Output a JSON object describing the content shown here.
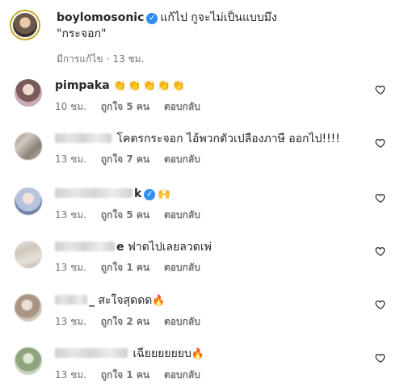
{
  "post": {
    "username": "boylomosonic",
    "caption_line1": "แก้ไป กูจะไม่เป็นแบบมึง",
    "caption_line2": "\"กระจอก\"",
    "edited_label": "มีการแก้ไข",
    "separator": "·",
    "time": "13 ชม."
  },
  "labels": {
    "reply": "ตอบกลับ"
  },
  "comments": [
    {
      "username": "pimpaka",
      "text": "",
      "emoji": "👏👏👏👏👏",
      "time": "10 ชม.",
      "likes": "ถูกใจ 5 คน",
      "avatar_color": "#c9a9b3"
    },
    {
      "username": "",
      "text": "โคตรกระจอก ไอ้พวกตัวเปลืองภาษี ออกไป!!!!",
      "emoji": "",
      "time": "13 ชม.",
      "likes": "ถูกใจ 7 คน",
      "avatar_color": "#b8b2aa"
    },
    {
      "username": "k",
      "text": "",
      "emoji": "🙌",
      "time": "13 ชม.",
      "likes": "ถูกใจ 5 คน",
      "avatar_color": "#9fb2cf"
    },
    {
      "username": "e",
      "text": "ฟาดไปเลยลวดเพ่",
      "emoji": "",
      "time": "13 ชม.",
      "likes": "ถูกใจ 1 คน",
      "avatar_color": "#d7d0c8"
    },
    {
      "username": "_",
      "text": "สะใจสุดดด",
      "emoji": "🔥",
      "time": "13 ชม.",
      "likes": "ถูกใจ 2 คน",
      "avatar_color": "#c7b9aa"
    },
    {
      "username": "",
      "text": "เฉียยยยยยบ",
      "emoji": "🔥",
      "time": "13 ชม.",
      "likes": "ถูกใจ 1 คน",
      "avatar_color": "#a9b99c"
    }
  ]
}
